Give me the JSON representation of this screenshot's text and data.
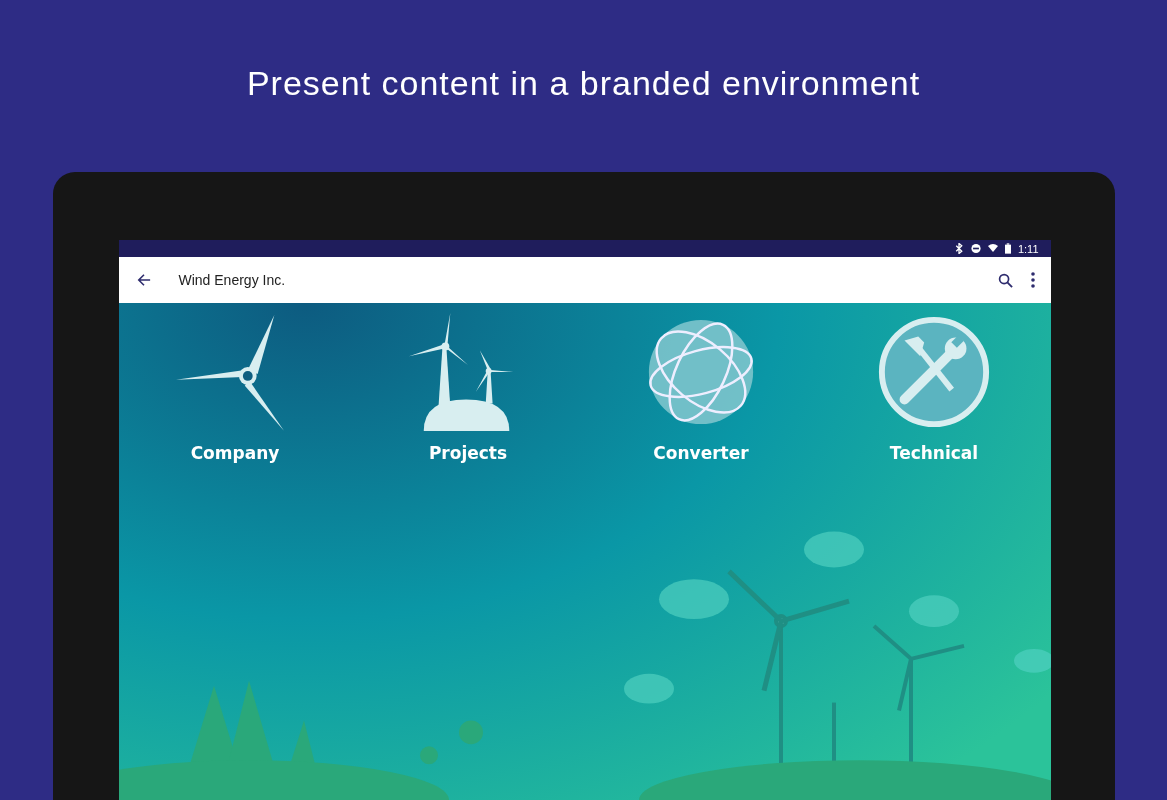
{
  "headline": "Present content in a branded environment",
  "status_bar": {
    "time": "1:11"
  },
  "app_bar": {
    "title": "Wind Energy Inc."
  },
  "tiles": [
    {
      "kind": "turbine",
      "label": "Company"
    },
    {
      "kind": "wind-farm",
      "label": "Projects"
    },
    {
      "kind": "globe",
      "label": "Converter"
    },
    {
      "kind": "tools",
      "label": "Technical"
    }
  ]
}
